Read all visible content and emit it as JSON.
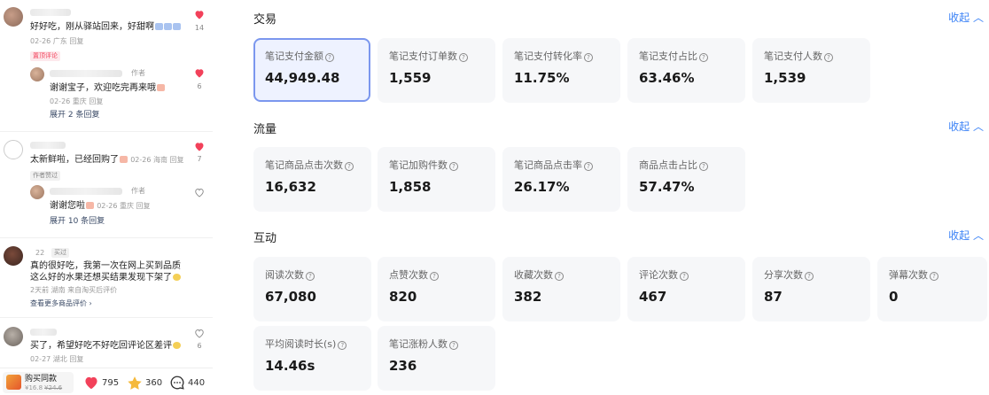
{
  "comments": [
    {
      "text": "好好吃，刚从驿站回来，好甜啊",
      "meta": "02-26 广东 回复",
      "tag": "置顶评论",
      "likes": "14",
      "reply": {
        "role": "作者",
        "text": "谢谢宝子，欢迎吃完再来哦",
        "meta": "02-26 重庆 回复",
        "likes": "6"
      },
      "expand": "展开 2 条回复"
    },
    {
      "text": "太新鲜啦，已经回购了",
      "meta": "02-26 海南 回复",
      "likes": "7",
      "tag": "作者赞过",
      "reply": {
        "role": "作者",
        "text": "谢谢您啦",
        "meta": "02-26 重庆 回复"
      },
      "expand": "展开 10 条回复"
    },
    {
      "user_hint": "22",
      "tag": "买过",
      "text_line1": "真的很好吃，我第一次在网上买到品质",
      "text_line2": "这么好的水果还想买结果发现下架了",
      "meta": "2天前 湖南 来自淘买后评价",
      "more": "查看更多商品评价"
    },
    {
      "text": "买了，希望好吃不好吃回评论区差评",
      "meta": "02-27 湖北 回复",
      "likes": "6"
    }
  ],
  "bottom_bar": {
    "buy_title": "购买同款",
    "buy_price": "¥16.8",
    "buy_old_price": "¥24.6",
    "likes": "795",
    "stars": "360",
    "comments": "440"
  },
  "sections": [
    {
      "title": "交易",
      "collapse": "收起",
      "cards": [
        {
          "label": "笔记支付金额",
          "value": "44,949.48",
          "selected": true
        },
        {
          "label": "笔记支付订单数",
          "value": "1,559"
        },
        {
          "label": "笔记支付转化率",
          "value": "11.75%"
        },
        {
          "label": "笔记支付占比",
          "value": "63.46%"
        },
        {
          "label": "笔记支付人数",
          "value": "1,539"
        }
      ]
    },
    {
      "title": "流量",
      "collapse": "收起",
      "cards": [
        {
          "label": "笔记商品点击次数",
          "value": "16,632"
        },
        {
          "label": "笔记加购件数",
          "value": "1,858"
        },
        {
          "label": "笔记商品点击率",
          "value": "26.17%"
        },
        {
          "label": "商品点击占比",
          "value": "57.47%"
        }
      ]
    },
    {
      "title": "互动",
      "collapse": "收起",
      "cards": [
        {
          "label": "阅读次数",
          "value": "67,080"
        },
        {
          "label": "点赞次数",
          "value": "820"
        },
        {
          "label": "收藏次数",
          "value": "382"
        },
        {
          "label": "评论次数",
          "value": "467"
        },
        {
          "label": "分享次数",
          "value": "87"
        },
        {
          "label": "弹幕次数",
          "value": "0"
        },
        {
          "label": "平均阅读时长(s)",
          "value": "14.46s"
        },
        {
          "label": "笔记涨粉人数",
          "value": "236"
        }
      ]
    }
  ],
  "icons": {
    "help": "?",
    "collapse": "chevron-up-icon",
    "heart_color": "#f2415a",
    "accent": "#3b82f6"
  }
}
